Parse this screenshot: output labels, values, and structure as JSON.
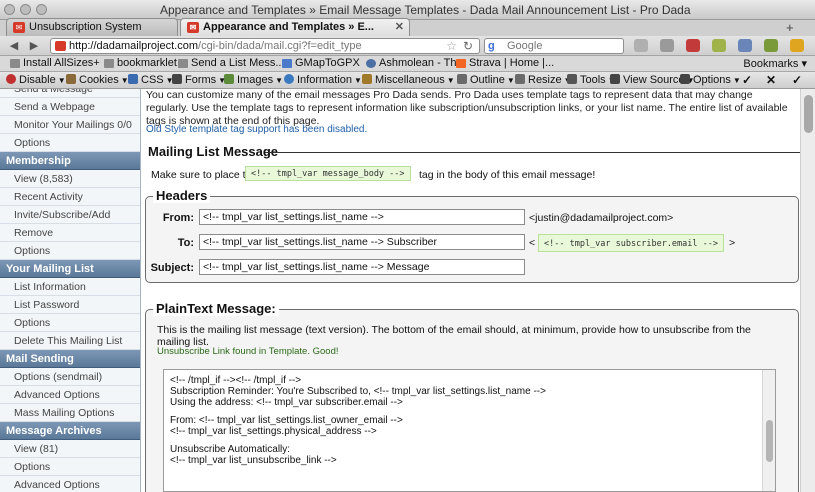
{
  "window": {
    "title": "Appearance and Templates » Email Message Templates - Dada Mail Announcement List - Pro Dada"
  },
  "tabs": [
    {
      "label": "Unsubscription System"
    },
    {
      "label": "Appearance and Templates » E..."
    }
  ],
  "nav": {
    "url_host": "http://dadamailproject.com",
    "url_path": "/cgi-bin/dada/mail.cgi?f=edit_type",
    "search_placeholder": "Google"
  },
  "bookmarks": {
    "items": [
      "Install AllSizes+",
      "bookmarklet",
      "Send a List Mess...",
      "GMapToGPX",
      "Ashmolean - Th...",
      "Strava | Home |..."
    ],
    "menu_label": "Bookmarks"
  },
  "devtoolbar": {
    "items": [
      "Disable",
      "Cookies",
      "CSS",
      "Forms",
      "Images",
      "Information",
      "Miscellaneous",
      "Outline",
      "Resize",
      "Tools",
      "View Source",
      "Options"
    ]
  },
  "sidebar": {
    "top_items": [
      "Send a Message",
      "Send a Webpage",
      "Monitor Your Mailings 0/0",
      "Options"
    ],
    "groups": [
      {
        "title": "Membership",
        "items": [
          "View (8,583)",
          "Recent Activity",
          "Invite/Subscribe/Add",
          "Remove",
          "Options"
        ]
      },
      {
        "title": "Your Mailing List",
        "items": [
          "List Information",
          "List Password",
          "Options",
          "Delete This Mailing List"
        ]
      },
      {
        "title": "Mail Sending",
        "items": [
          "Options (sendmail)",
          "Advanced Options",
          "Mass Mailing Options"
        ]
      },
      {
        "title": "Message Archives",
        "items": [
          "View (81)",
          "Options",
          "Advanced Options"
        ]
      }
    ]
  },
  "main": {
    "intro": "You can customize many of the email messages Pro Dada sends. Pro Dada uses template tags to represent data that may change regularly. Use the template tags to represent information like subscription/unsubscription links, or your list name. The entire list of available tags is shown at the end of this page.",
    "old_style_notice": "Old Style template tag support has been disabled.",
    "mailing_list_message": {
      "heading": "Mailing List Message",
      "text_before": "Make sure to place the",
      "tag": "<!-- tmpl_var message_body -->",
      "text_after": "tag in the body of this email message!"
    },
    "headers": {
      "heading": "Headers",
      "from_label": "From:",
      "from_value": "<!-- tmpl_var list_settings.list_name -->",
      "from_email": "<justin@dadamailproject.com>",
      "to_label": "To:",
      "to_value": "<!-- tmpl_var list_settings.list_name --> Subscriber",
      "to_lt": "<",
      "to_tag": "<!-- tmpl_var subscriber.email -->",
      "to_gt": ">",
      "subject_label": "Subject:",
      "subject_value": "<!-- tmpl_var list_settings.list_name --> Message"
    },
    "plaintext": {
      "heading": "PlainText Message:",
      "description": "This is the mailing list message (text version). The bottom of the email should, at minimum, provide how to unsubscribe from the mailing list.",
      "status": "Unsubscribe Link found in Template. Good!",
      "body_lines": [
        "<!-- /tmpl_if --><!-- /tmpl_if -->",
        "Subscription Reminder: You're Subscribed to, <!-- tmpl_var list_settings.list_name -->",
        "Using the address: <!-- tmpl_var subscriber.email -->",
        "",
        "From: <!-- tmpl_var list_settings.list_owner_email -->",
        "<!-- tmpl_var list_settings.physical_address -->",
        "",
        "Unsubscribe Automatically:",
        "<!-- tmpl_var list_unsubscribe_link -->"
      ]
    }
  }
}
